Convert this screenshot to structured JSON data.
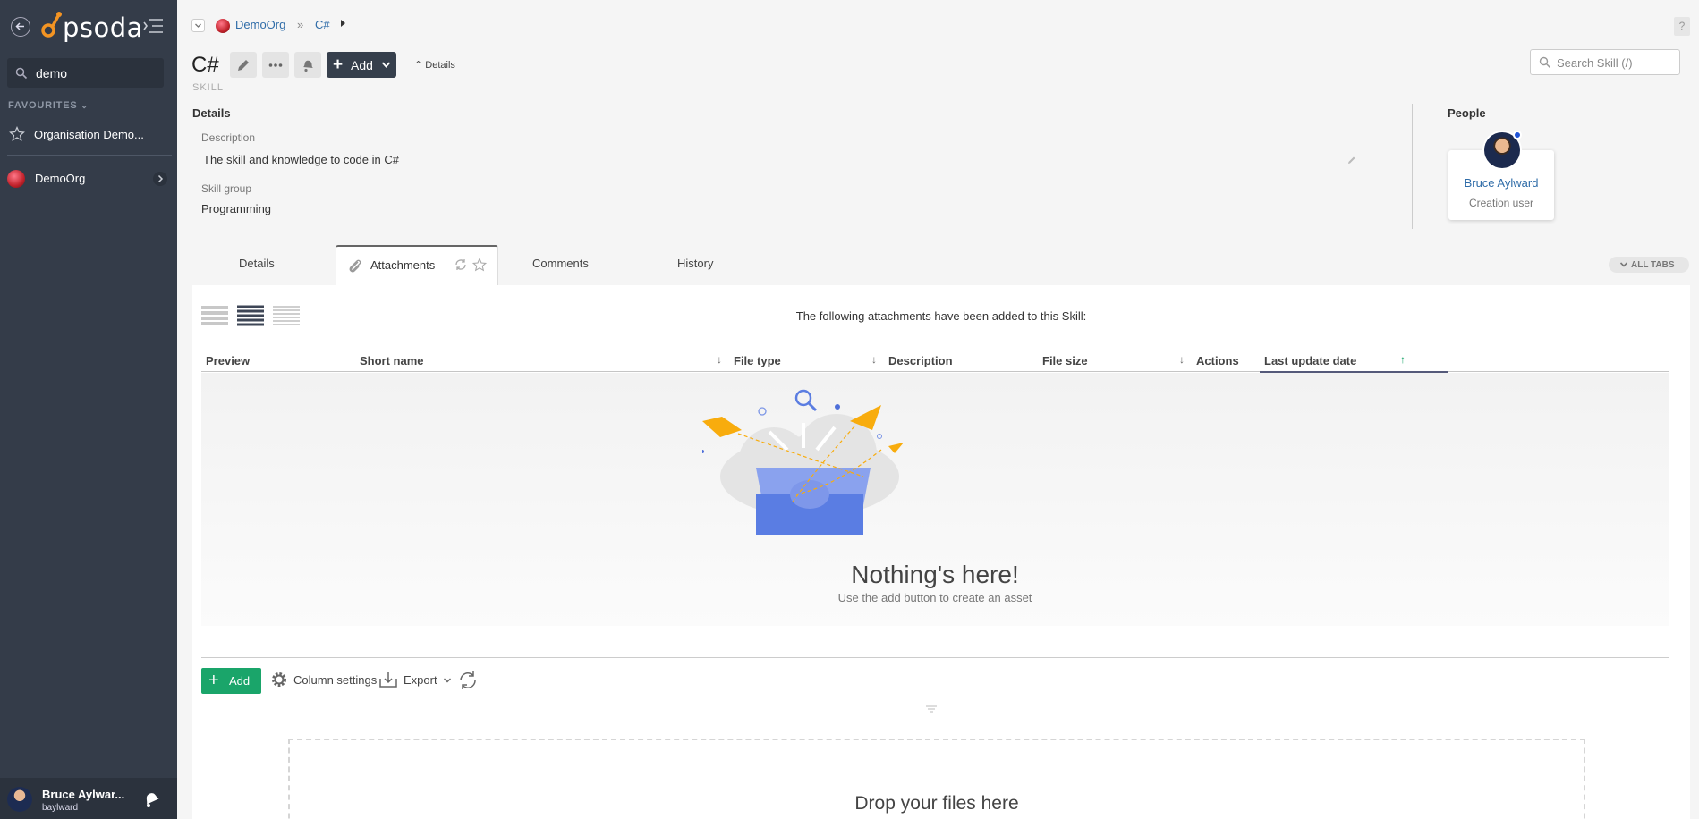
{
  "sidebar": {
    "logo_text": "psoda",
    "search_value": "demo",
    "favourites_label": "FAVOURITES",
    "favourite_items": [
      {
        "label": "Organisation Demo..."
      }
    ],
    "org_item": {
      "label": "DemoOrg"
    },
    "user": {
      "name": "Bruce Aylwar...",
      "login": "baylward"
    }
  },
  "breadcrumb": {
    "org": "DemoOrg",
    "separator": "»",
    "current": "C#"
  },
  "header": {
    "title": "C#",
    "type_label": "SKILL",
    "add_label": "Add",
    "details_toggle": "Details",
    "search_placeholder": "Search Skill (/)",
    "help_label": "?"
  },
  "details": {
    "heading": "Details",
    "description_label": "Description",
    "description_value": "The skill and knowledge to code in C#",
    "skill_group_label": "Skill group",
    "skill_group_value": "Programming"
  },
  "people": {
    "heading": "People",
    "person_name": "Bruce Aylward",
    "person_role": "Creation user"
  },
  "tabs": [
    {
      "label": "Details"
    },
    {
      "label": "Attachments",
      "active": true
    },
    {
      "label": "Comments"
    },
    {
      "label": "History"
    }
  ],
  "all_tabs_label": "ALL TABS",
  "attachments": {
    "note": "The following attachments have been added to this Skill:",
    "columns": [
      "Preview",
      "Short name",
      "File type",
      "Description",
      "File size",
      "Actions",
      "Last update date"
    ],
    "empty_title": "Nothing's here!",
    "empty_subtitle": "Use the add button to create an asset",
    "add_label": "Add",
    "column_settings_label": "Column settings",
    "export_label": "Export",
    "drop_label": "Drop your files here"
  },
  "colors": {
    "sidebar_bg": "#343c49",
    "accent_blue": "#2f6ca8",
    "green": "#1aa56a",
    "dark_button": "#363f4c",
    "logo_orange": "#f39423"
  }
}
